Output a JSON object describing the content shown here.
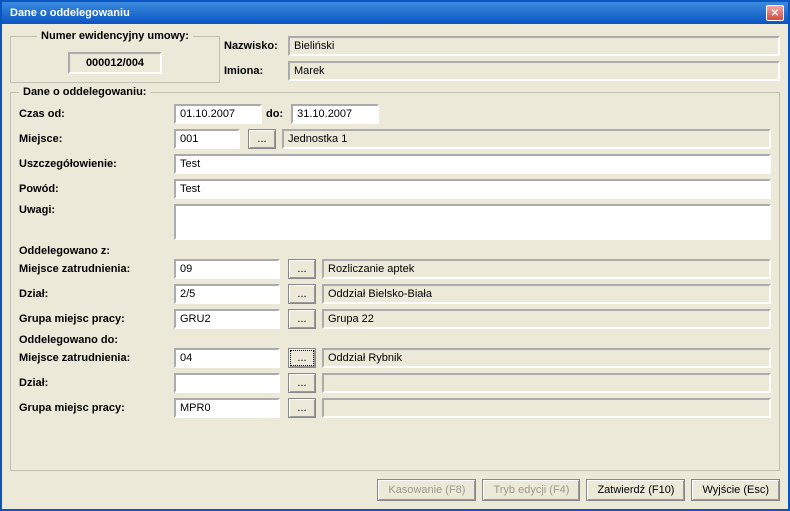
{
  "title": "Dane o oddelegowaniu",
  "numer_group": "Numer ewidencyjny umowy:",
  "numer": "000012/004",
  "nazwisko_label": "Nazwisko:",
  "nazwisko": "Bieliński",
  "imiona_label": "Imiona:",
  "imiona": "Marek",
  "delegation": {
    "legend": "Dane o oddelegowaniu:",
    "czas_od_label": "Czas od:",
    "czas_od": "01.10.2007",
    "do_label": "do:",
    "do": "31.10.2007",
    "miejsce_label": "Miejsce:",
    "miejsce_code": "001",
    "miejsce_name": "Jednostka 1",
    "uszcz_label": "Uszczegółowienie:",
    "uszcz": "Test",
    "powod_label": "Powód:",
    "powod": "Test",
    "uwagi_label": "Uwagi:",
    "uwagi": "",
    "from_label": "Oddelegowano z:",
    "mz_label": "Miejsce zatrudnienia:",
    "from_mz_code": "09",
    "from_mz_name": "Rozliczanie aptek",
    "dzial_label": "Dział:",
    "from_dzial_code": "2/5",
    "from_dzial_name": "Oddział Bielsko-Biała",
    "gmp_label": "Grupa miejsc pracy:",
    "from_gmp_code": "GRU2",
    "from_gmp_name": "Grupa 22",
    "to_label": "Oddelegowano do:",
    "to_mz_code": "04",
    "to_mz_name": "Oddział Rybnik",
    "to_dzial_code": "",
    "to_dzial_name": "",
    "to_gmp_code": "MPR0",
    "to_gmp_name": ""
  },
  "browse": "...",
  "buttons": {
    "kasowanie": "Kasowanie (F8)",
    "tryb": "Tryb edycji (F4)",
    "zatw": "Zatwierdź (F10)",
    "wyjscie": "Wyjście (Esc)"
  }
}
